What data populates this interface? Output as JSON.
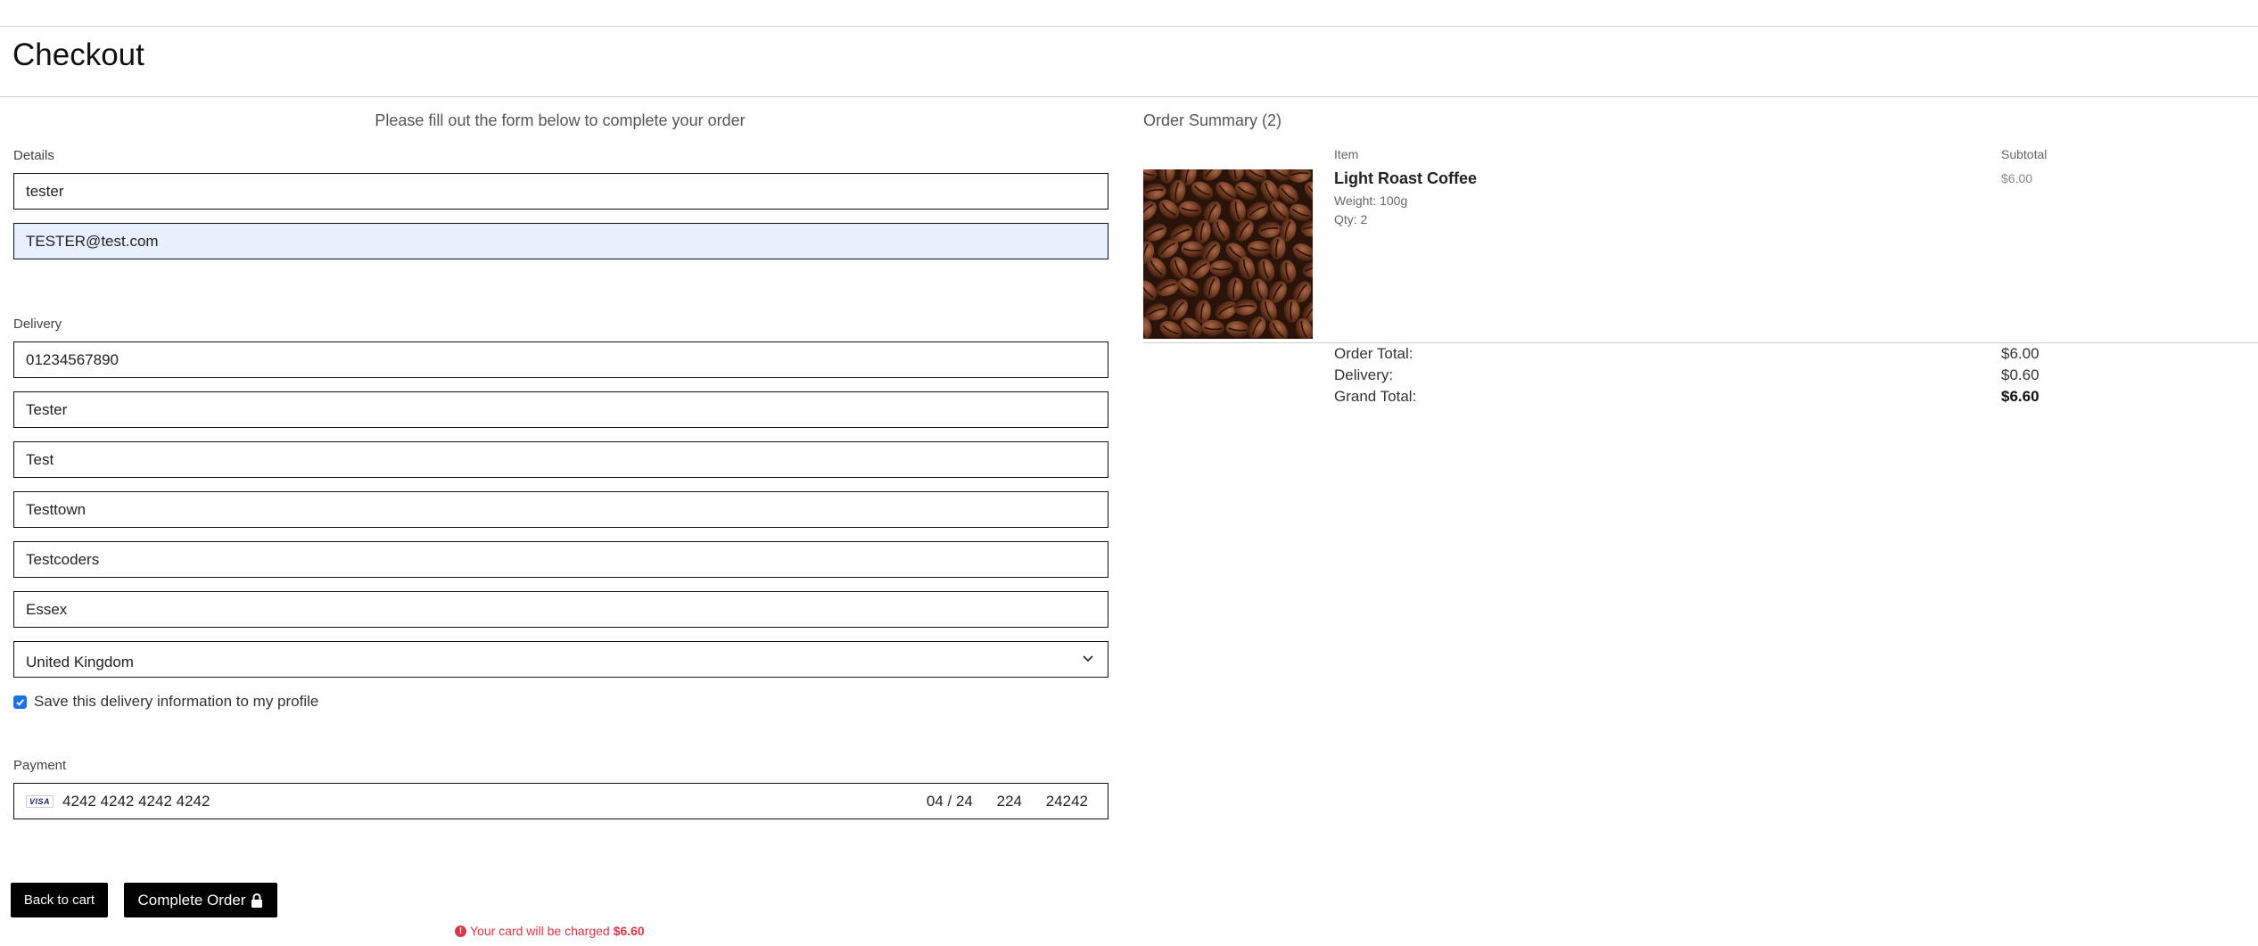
{
  "page": {
    "title": "Checkout",
    "instructions": "Please fill out the form below to complete your order"
  },
  "details": {
    "label": "Details",
    "full_name": "tester",
    "email": "TESTER@test.com"
  },
  "delivery": {
    "label": "Delivery",
    "phone": "01234567890",
    "street_address1": "Tester",
    "street_address2": "Test",
    "town_or_city": "Testtown",
    "postcode": "Testcoders",
    "county": "Essex",
    "country": "United Kingdom",
    "save_info_label": "Save this delivery information to my profile",
    "save_info_checked": true
  },
  "payment": {
    "label": "Payment",
    "card_brand": "VISA",
    "card_number": "4242 4242 4242 4242",
    "expiry": "04 / 24",
    "cvc": "224",
    "postal": "24242"
  },
  "actions": {
    "back_label": "Back to cart",
    "complete_label": "Complete Order",
    "charge_note": "Your card will be charged",
    "charge_amount": "$6.60"
  },
  "summary": {
    "title": "Order Summary (2)",
    "col_item": "Item",
    "col_subtotal": "Subtotal",
    "items": [
      {
        "name": "Light Roast Coffee",
        "weight": "Weight: 100g",
        "qty": "Qty: 2",
        "subtotal": "$6.00",
        "image": "coffee-beans-image"
      }
    ],
    "order_total_label": "Order Total:",
    "order_total": "$6.00",
    "delivery_label": "Delivery:",
    "delivery_cost": "$0.60",
    "grand_total_label": "Grand Total:",
    "grand_total": "$6.60"
  },
  "colors": {
    "button_bg": "#000000",
    "error": "#dc3545",
    "checkbox": "#1a73e8",
    "autofill": "#e8f0fe"
  }
}
